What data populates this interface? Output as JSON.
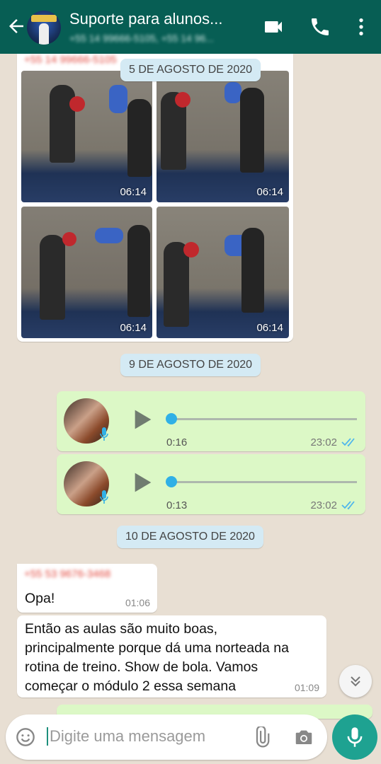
{
  "header": {
    "title": "Suporte para alunos...",
    "subtitle": "+55 14 99666-5105, +55 14 96...",
    "icons": [
      "back-arrow-icon",
      "video-call-icon",
      "phone-icon",
      "more-options-icon"
    ]
  },
  "chat": {
    "blurred_top_sender": "+55 14 99666-5105",
    "dates": [
      "5 DE AGOSTO DE 2020",
      "9 DE AGOSTO DE 2020",
      "10 DE AGOSTO DE 2020"
    ],
    "photos": [
      {
        "time": "06:14"
      },
      {
        "time": "06:14"
      },
      {
        "time": "06:14"
      },
      {
        "time": "06:14"
      }
    ],
    "voice_notes": [
      {
        "duration": "0:16",
        "time": "23:02",
        "progress": 0
      },
      {
        "duration": "0:13",
        "time": "23:02",
        "progress": 0
      }
    ],
    "messages": [
      {
        "sender": "+55 53 9676-3468",
        "text": "Opa!",
        "time": "01:06"
      },
      {
        "text": "Então as aulas são muito boas, principalmente porque dá uma norteada na rotina de treino. Show de bola. Vamos começar o módulo 2 essa semana",
        "time": "01:09"
      }
    ]
  },
  "composer": {
    "placeholder": "Digite uma mensagem",
    "icons": [
      "emoji-icon",
      "attach-icon",
      "camera-icon",
      "mic-icon"
    ]
  },
  "colors": {
    "header": "#075e54",
    "outgoing": "#dcf8c6",
    "incoming": "#ffffff",
    "date_pill": "#d4eaf4",
    "accent": "#1ea291",
    "read_ticks": "#4fb6ec"
  }
}
